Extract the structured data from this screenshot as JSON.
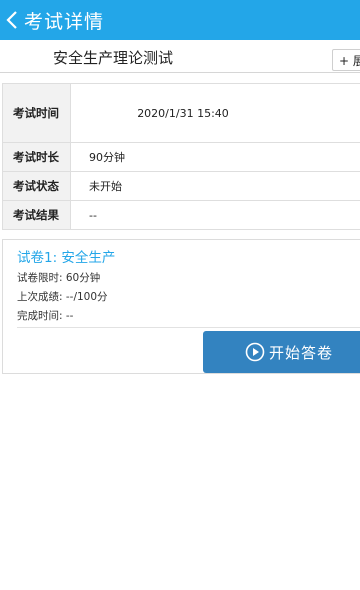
{
  "app": {
    "title": "考试详情"
  },
  "exam": {
    "name": "安全生产理论测试",
    "expand_label": "+ 展开"
  },
  "details": [
    {
      "label": "考试时间",
      "value": "2020/1/31 15:40"
    },
    {
      "label": "考试时长",
      "value": "90分钟"
    },
    {
      "label": "考试状态",
      "value": "未开始"
    },
    {
      "label": "考试结果",
      "value": "--"
    }
  ],
  "paper": {
    "title": "试卷1: 安全生产",
    "time_limit": "试卷限时: 60分钟",
    "last_score": "上次成绩: --/100分",
    "completed_time": "完成时间: --",
    "start_label": "开始答卷"
  },
  "colors": {
    "topbar": "#23a6e8",
    "accent_text": "#23a6e8",
    "start_button": "#3383c0"
  }
}
